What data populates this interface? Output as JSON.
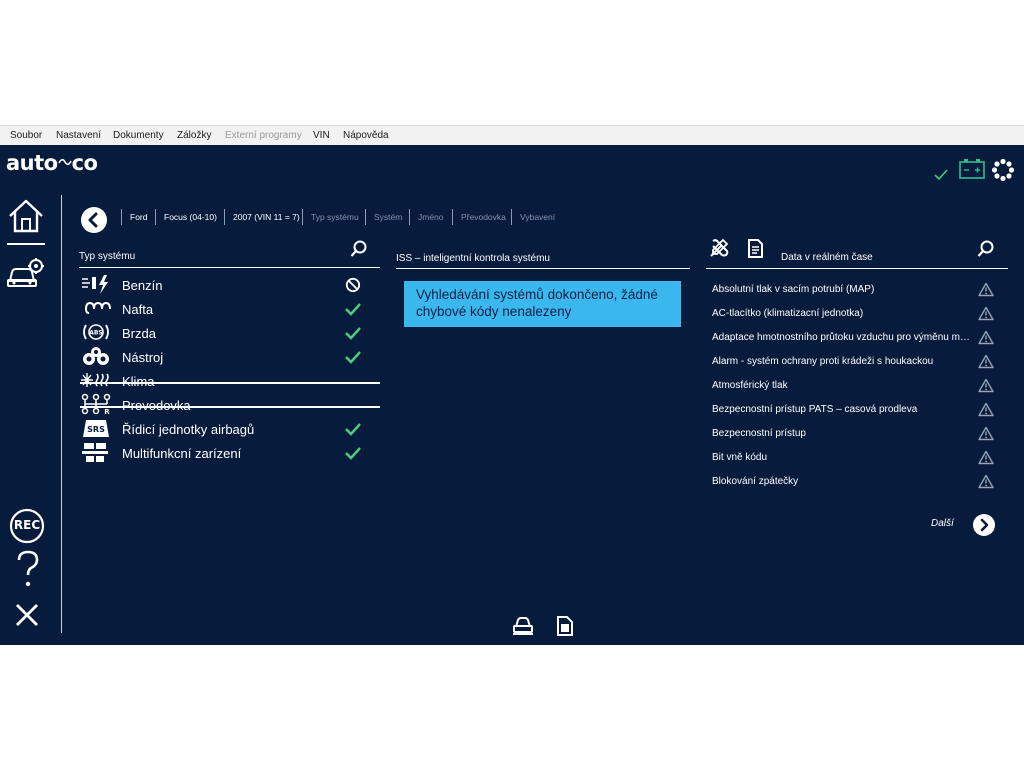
{
  "menu": [
    "Soubor",
    "Nastavení",
    "Dokumenty",
    "Záložky",
    "Externí programy",
    "VIN",
    "Nápověda"
  ],
  "app": {
    "logo_left": "auto",
    "logo_mid": "",
    "logo_right": "co"
  },
  "breadcrumb": [
    "Ford",
    "Focus (04-10)",
    "2007 (VIN 11 = 7)",
    "Typ systému",
    "Systém",
    "Jméno",
    "Převodovka",
    "Vybavení"
  ],
  "left_panel": {
    "title": "Typ systému",
    "systems": [
      {
        "label": "Benzín",
        "icon": "fuel-injection-icon",
        "status": "blocked",
        "strike": false
      },
      {
        "label": "Nafta",
        "icon": "diesel-glow-plug-icon",
        "status": "ok",
        "strike": false
      },
      {
        "label": "Brzda",
        "icon": "abs-brake-icon",
        "status": "ok",
        "strike": false
      },
      {
        "label": "Nástroj",
        "icon": "gauges-icon",
        "status": "ok",
        "strike": false
      },
      {
        "label": "Klima",
        "icon": "air-conditioning-icon",
        "status": "none",
        "strike": true
      },
      {
        "label": "Prevodovka",
        "icon": "gearbox-icon",
        "status": "none",
        "strike": true
      },
      {
        "label": "Řídicí jednotky airbagů",
        "icon": "srs-airbag-icon",
        "status": "ok",
        "strike": false
      },
      {
        "label": "Multifunkcní zarízení",
        "icon": "multifunction-icon",
        "status": "ok",
        "strike": false
      }
    ]
  },
  "center_panel": {
    "title": "ISS – inteligentní kontrola systému",
    "message": "Vyhledávání systémů dokončeno, žádné chybové kódy nenalezeny"
  },
  "right_panel": {
    "title": "Data v reálném čase",
    "items": [
      "Absolutní tlak v sacím potrubí (MAP)",
      "AC-tlacítko (klimatizacní jednotka)",
      "Adaptace hmotnostního průtoku vzduchu pro výměnu motoru",
      "Alarm - systém ochrany proti krádeži s houkackou",
      "Atmosférický tlak",
      "Bezpecnostní prístup PATS – casová prodleva",
      "Bezpecnostní prístup",
      "Bit vně kódu",
      "Blokování zpátečky"
    ],
    "next_label": "Další"
  },
  "sidebar": {
    "rec_label": "REC"
  },
  "colors": {
    "background": "#071b3d",
    "ok": "#49c97a",
    "info_box": "#3ab8ee",
    "battery": "#2fbf8f"
  }
}
